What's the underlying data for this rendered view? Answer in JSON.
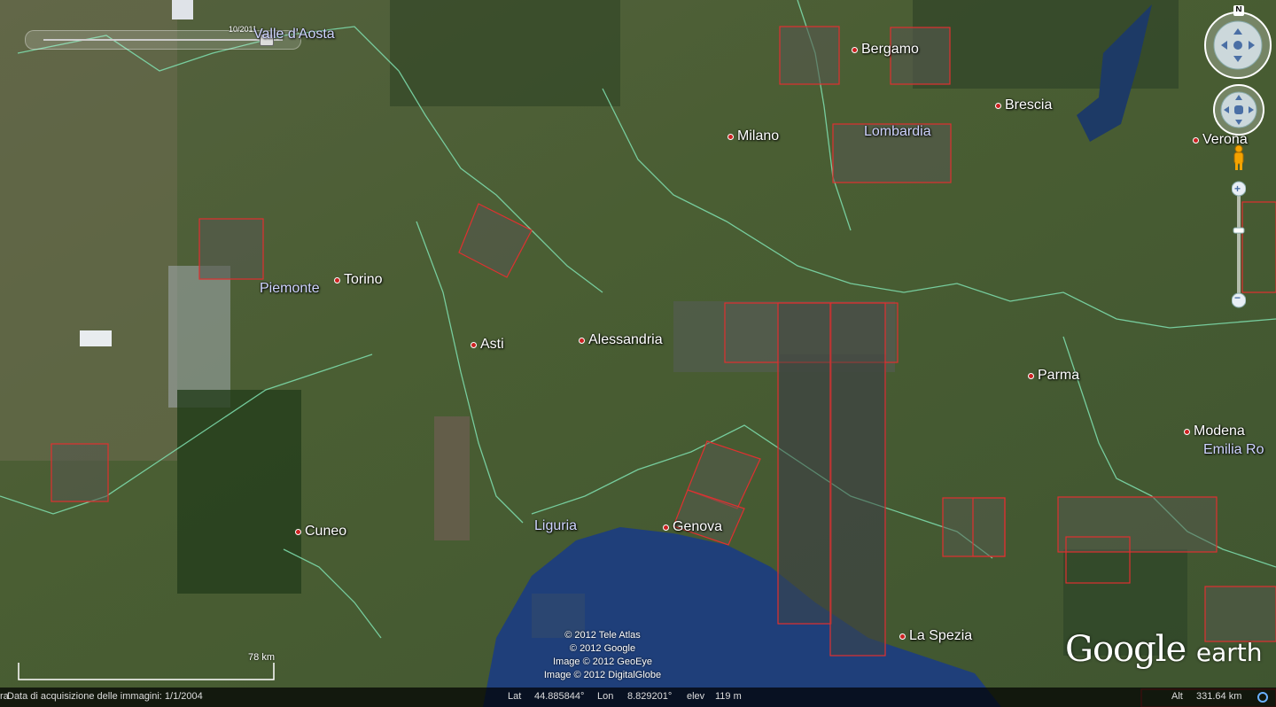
{
  "app": {
    "name": "Google Earth"
  },
  "time_slider": {
    "date_label": "10/2011"
  },
  "compass": {
    "north_label": "N"
  },
  "zoom": {
    "plus": "+",
    "minus": "−",
    "level": 0.38
  },
  "scale": {
    "label": "78 km"
  },
  "cities": [
    {
      "name": "Bergamo"
    },
    {
      "name": "Brescia"
    },
    {
      "name": "Milano"
    },
    {
      "name": "Verona"
    },
    {
      "name": "Torino"
    },
    {
      "name": "Asti"
    },
    {
      "name": "Alessandria"
    },
    {
      "name": "Parma"
    },
    {
      "name": "Modena"
    },
    {
      "name": "Cuneo"
    },
    {
      "name": "Genova"
    },
    {
      "name": "La Spezia"
    }
  ],
  "regions": [
    {
      "name": "Valle d'Aosta"
    },
    {
      "name": "Lombardia"
    },
    {
      "name": "Piemonte"
    },
    {
      "name": "Liguria"
    },
    {
      "name": "Emilia Ro"
    }
  ],
  "credits": [
    "© 2012 Tele Atlas",
    "© 2012 Google",
    "Image © 2012 GeoEye",
    "Image © 2012 DigitalGlobe"
  ],
  "status": {
    "imagery_date": "Data di acquisizione delle immagini: 1/1/2004",
    "lat_label": "Lat",
    "lat_value": "44.885844°",
    "lon_label": "Lon",
    "lon_value": "8.829201°",
    "elev_label": "elev",
    "elev_value": "119 m",
    "alt_label": "Alt",
    "alt_value": "331.64 km",
    "left_edge": "ra"
  },
  "logo": {
    "main": "Google",
    "suffix": "earth"
  },
  "colors": {
    "border_red": "#e03030",
    "boundary_green": "#7fe0b0",
    "sea": "#1f3f7a"
  }
}
